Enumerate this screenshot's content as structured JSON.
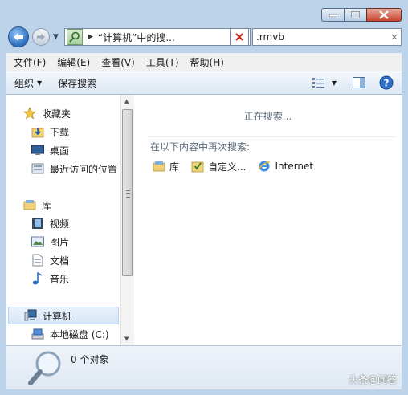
{
  "address": {
    "text": "“计算机”中的搜..."
  },
  "search": {
    "value": ".rmvb"
  },
  "menu": [
    "文件(F)",
    "编辑(E)",
    "查看(V)",
    "工具(T)",
    "帮助(H)"
  ],
  "toolbar": {
    "organize": "组织",
    "save_search": "保存搜索"
  },
  "nav": {
    "favorites": "收藏夹",
    "downloads": "下载",
    "desktop": "桌面",
    "recent": "最近访问的位置",
    "libraries": "库",
    "videos": "视频",
    "pictures": "图片",
    "documents": "文档",
    "music": "音乐",
    "computer": "计算机",
    "local_disk": "本地磁盘 (C:)"
  },
  "main": {
    "searching": "正在搜索...",
    "search_again": "在以下内容中再次搜索:",
    "locations": [
      "库",
      "自定义...",
      "Internet"
    ]
  },
  "details": {
    "count": "0 个对象"
  },
  "watermark": "头条@问答"
}
